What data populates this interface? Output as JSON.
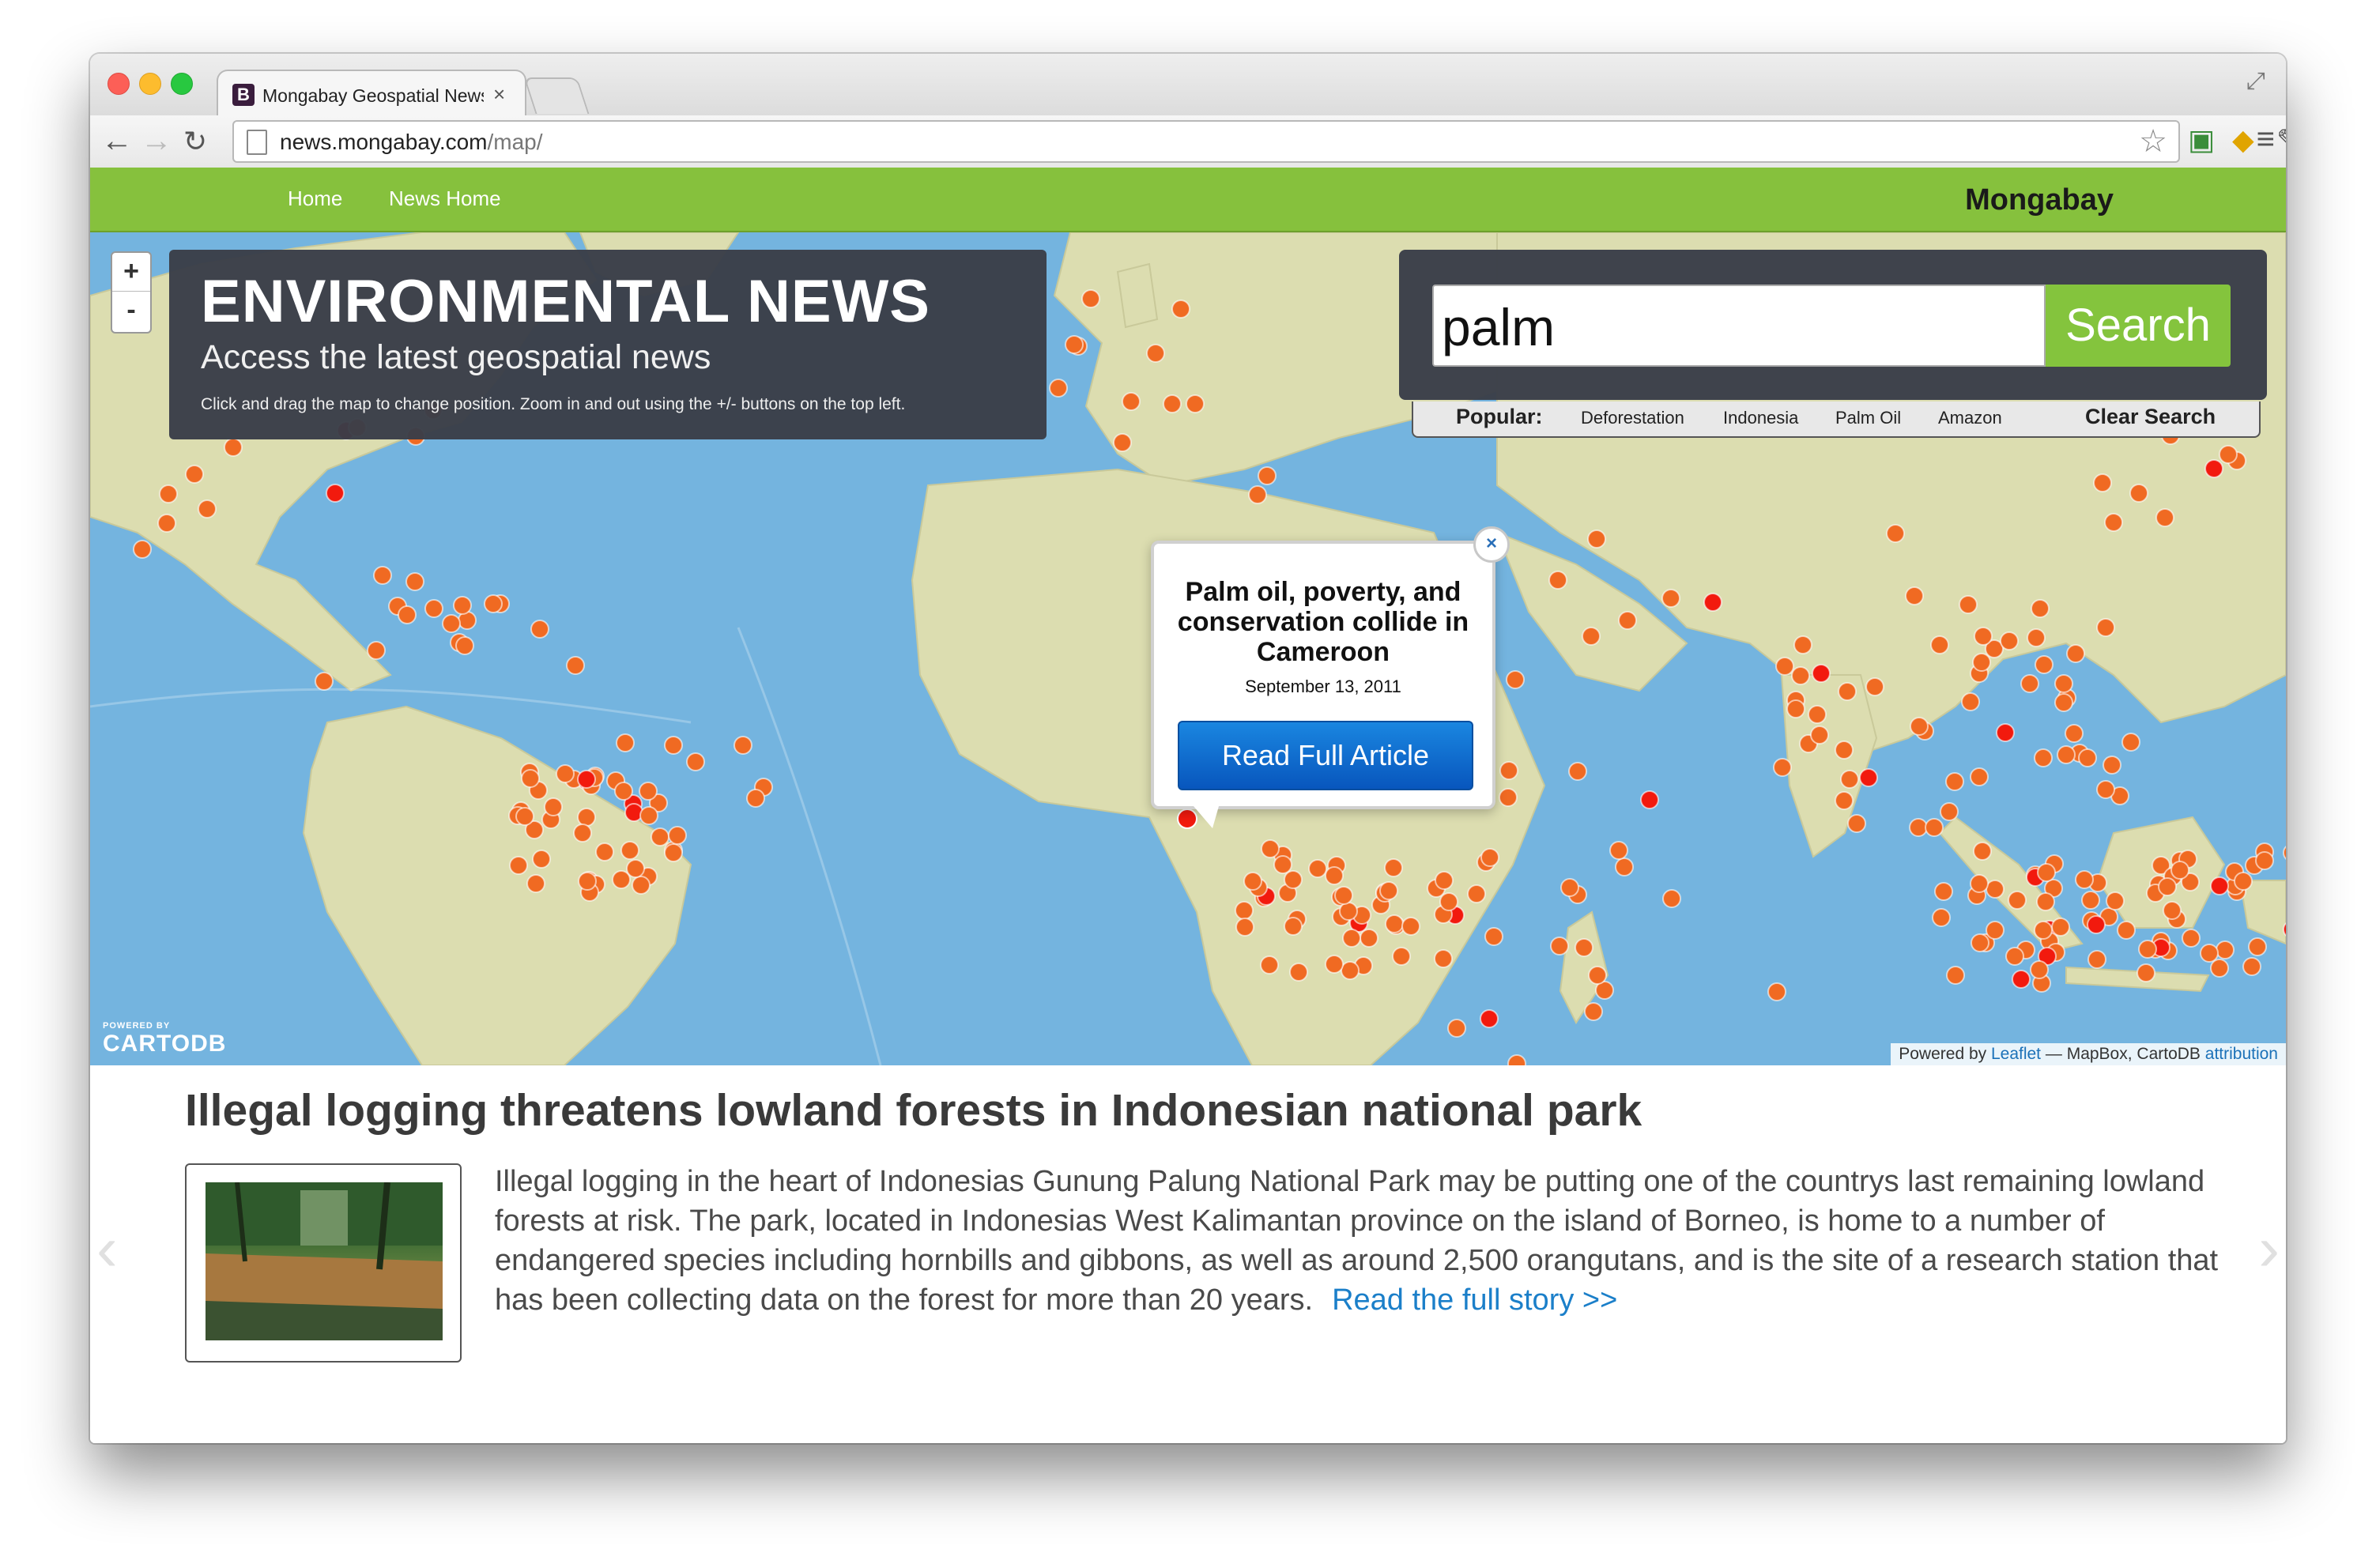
{
  "browser": {
    "tab_favicon": "B",
    "tab_title": "Mongabay Geospatial News",
    "tab_close": "×",
    "url_host": "news.mongabay.com",
    "url_path": "/map/"
  },
  "navbar": {
    "links": [
      "Home",
      "News Home"
    ],
    "brand": "Mongabay"
  },
  "header": {
    "title": "ENVIRONMENTAL NEWS",
    "subtitle": "Access the latest geospatial news",
    "hint": "Click and drag the map to change position. Zoom in and out using the +/- buttons on the top left."
  },
  "zoom": {
    "in": "+",
    "out": "-"
  },
  "search": {
    "value": "palm",
    "button": "Search",
    "popular_label": "Popular:",
    "popular": [
      "Deforestation",
      "Indonesia",
      "Palm Oil",
      "Amazon"
    ],
    "clear": "Clear Search"
  },
  "popup": {
    "close": "×",
    "title": "Palm oil, poverty, and conservation collide in Cameroon",
    "date": "September 13, 2011",
    "button": "Read Full Article"
  },
  "map_credits": {
    "cartodb_small": "POWERED BY",
    "cartodb": "CARTODB",
    "attribution_prefix": "Powered by ",
    "leaflet": "Leaflet",
    "attribution_middle": " — MapBox, CartoDB ",
    "attribution_link": "attribution"
  },
  "article": {
    "title": "Illegal logging threatens lowland forests in Indonesian national park",
    "body": "Illegal logging in the heart of Indonesias Gunung Palung National Park may be putting one of the countrys last remaining lowland forests at risk. The park, located in Indonesias West Kalimantan province on the island of Borneo, is home to a number of endangered species including hornbills and gibbons, as well as around 2,500 orangutans, and is the site of a research station that has been collecting data on the forest for more than 20 years.",
    "read_more": "Read the full story >>"
  },
  "carousel": {
    "prev": "‹",
    "next": "›"
  },
  "colors": {
    "navbar": "#86c13d",
    "ocean": "#74b4df",
    "land": "#d9dcae",
    "marker": "#f06a22",
    "marker_highlight": "#f21a0e",
    "panel": "#3a3e48",
    "link": "#1b7fc9"
  }
}
